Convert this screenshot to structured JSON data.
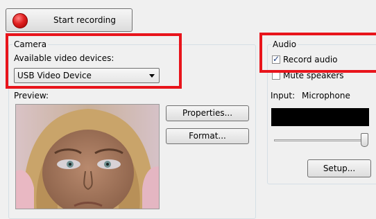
{
  "record": {
    "label": "Start recording"
  },
  "camera": {
    "title": "Camera",
    "devices_label": "Available video devices:",
    "selected_device": "USB Video Device",
    "preview_label": "Preview:",
    "properties_button": "Properties...",
    "format_button": "Format..."
  },
  "audio": {
    "title": "Audio",
    "record_audio_label": "Record audio",
    "record_audio_checked": true,
    "mute_speakers_label": "Mute speakers",
    "mute_speakers_checked": false,
    "input_label": "Input:",
    "input_value": "Microphone",
    "volume_level": 0.98,
    "setup_button": "Setup..."
  },
  "colors": {
    "annotation": "#e8141b",
    "record_dot": "#e02020",
    "level_meter": "#000000"
  }
}
